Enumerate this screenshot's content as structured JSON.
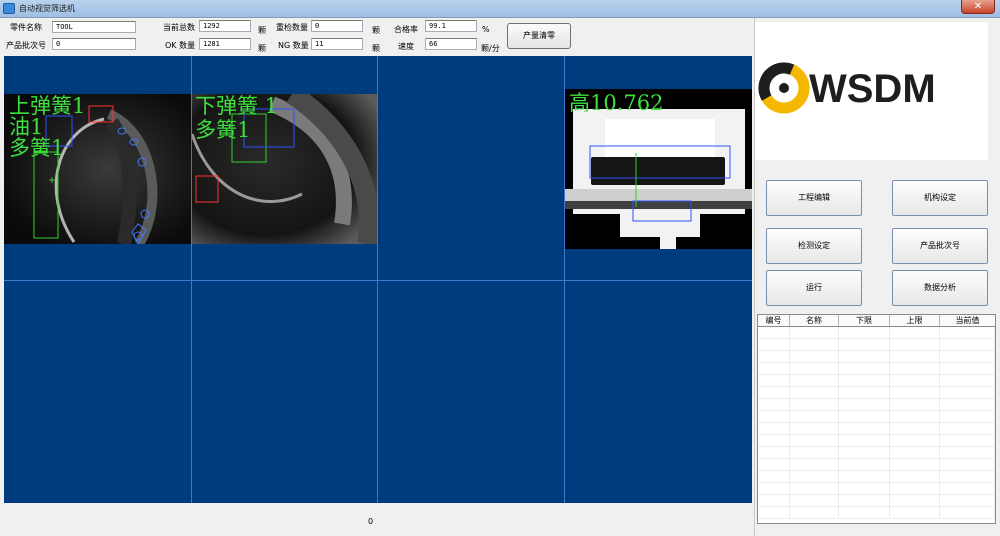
{
  "window": {
    "title": "自动视觉筛选机",
    "close_glyph": "✕"
  },
  "header": {
    "part_name_label": "零件名称",
    "part_name_value": "TOOL",
    "batch_label": "产品批次号",
    "batch_value": "0",
    "total_label": "当前总数",
    "total_value": "1292",
    "total_unit": "颗",
    "ok_label": "OK 数量",
    "ok_value": "1281",
    "ok_unit": "颗",
    "recheck_label": "重检数量",
    "recheck_value": "0",
    "recheck_unit": "颗",
    "ng_label": "NG 数量",
    "ng_value": "11",
    "ng_unit": "颗",
    "pass_label": "合格率",
    "pass_value": "99.1",
    "pass_unit": "%",
    "speed_label": "速度",
    "speed_value": "66",
    "speed_unit": "颗/分",
    "clear_button": "产量清零"
  },
  "cameras": {
    "cam1": {
      "lines": [
        "上弹簧1",
        "油1",
        "多簧1"
      ]
    },
    "cam2": {
      "lines": [
        "下弹簧 1",
        "多簧1"
      ]
    },
    "cam3": {
      "lines": [
        "高10.762"
      ]
    }
  },
  "status": {
    "value": "0"
  },
  "logo": {
    "text": "WSDM"
  },
  "buttons": {
    "project_edit": "工程编辑",
    "mechanism": "机构设定",
    "detection": "检测设定",
    "batch_no": "产品批次号",
    "run": "运行",
    "analysis": "数据分析"
  },
  "table": {
    "headers": [
      "编号",
      "名称",
      "下限",
      "上限",
      "当前值"
    ]
  },
  "colors": {
    "panel_bg": "#003b7e",
    "overlay_text": "#3de03d"
  }
}
